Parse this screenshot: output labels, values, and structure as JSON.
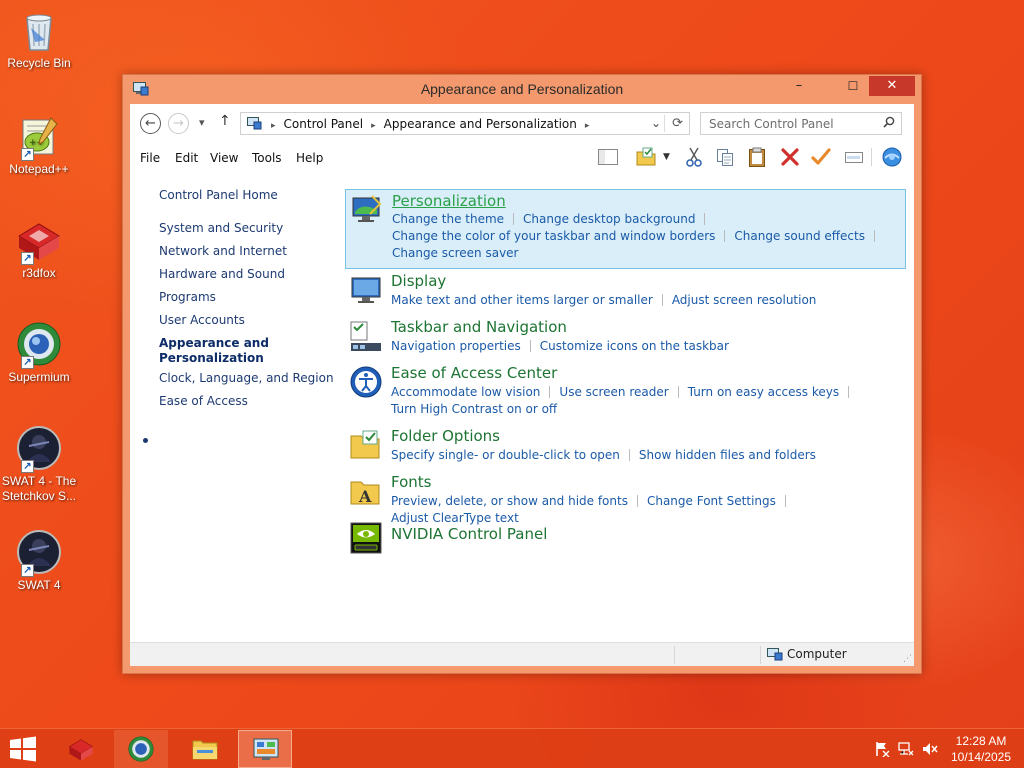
{
  "desktop": {
    "icons": [
      {
        "label": "Recycle Bin"
      },
      {
        "label": "Notepad++"
      },
      {
        "label": "r3dfox"
      },
      {
        "label": "Supermium"
      },
      {
        "label": "SWAT 4 - The Stetchkov S..."
      },
      {
        "label": "SWAT 4"
      }
    ]
  },
  "window": {
    "title": "Appearance and Personalization",
    "controls": {
      "minimize": "–",
      "maximize": "☐",
      "close": "✕"
    },
    "nav": {
      "back": "←",
      "forward": "→",
      "recent": "▾",
      "up": "↑"
    },
    "address": {
      "crumbs": [
        "Control Panel",
        "Appearance and Personalization"
      ],
      "separator": "▸",
      "dropdown": "⌄",
      "refresh": "⟳"
    },
    "search": {
      "placeholder": "Search Control Panel",
      "icon": "magnifier-icon"
    },
    "menu": [
      "File",
      "Edit",
      "View",
      "Tools",
      "Help"
    ],
    "left_nav": {
      "items": [
        "Control Panel Home",
        "System and Security",
        "Network and Internet",
        "Hardware and Sound",
        "Programs",
        "User Accounts",
        "Appearance and Personalization",
        "Clock, Language, and Region",
        "Ease of Access"
      ],
      "current": "Appearance and Personalization"
    },
    "categories": [
      {
        "title": "Personalization",
        "links": [
          "Change the theme",
          "Change desktop background",
          "Change the color of your taskbar and window borders",
          "Change sound effects",
          "Change screen saver"
        ],
        "highlighted": true
      },
      {
        "title": "Display",
        "links": [
          "Make text and other items larger or smaller",
          "Adjust screen resolution"
        ]
      },
      {
        "title": "Taskbar and Navigation",
        "links": [
          "Navigation properties",
          "Customize icons on the taskbar"
        ]
      },
      {
        "title": "Ease of Access Center",
        "links": [
          "Accommodate low vision",
          "Use screen reader",
          "Turn on easy access keys",
          "Turn High Contrast on or off"
        ]
      },
      {
        "title": "Folder Options",
        "links": [
          "Specify single- or double-click to open",
          "Show hidden files and folders"
        ]
      },
      {
        "title": "Fonts",
        "links": [
          "Preview, delete, or show and hide fonts",
          "Change Font Settings",
          "Adjust ClearType text"
        ]
      },
      {
        "title": "NVIDIA Control Panel",
        "links": []
      }
    ],
    "status": {
      "location": "Computer"
    }
  },
  "taskbar": {
    "clock": {
      "time": "12:28 AM",
      "date": "10/14/2025"
    }
  },
  "colors": {
    "accent": "#e9471b",
    "link": "#1b5aa8",
    "category_title": "#1d7433",
    "highlight_bg": "#d9eef8",
    "close_red": "#c7382b"
  }
}
